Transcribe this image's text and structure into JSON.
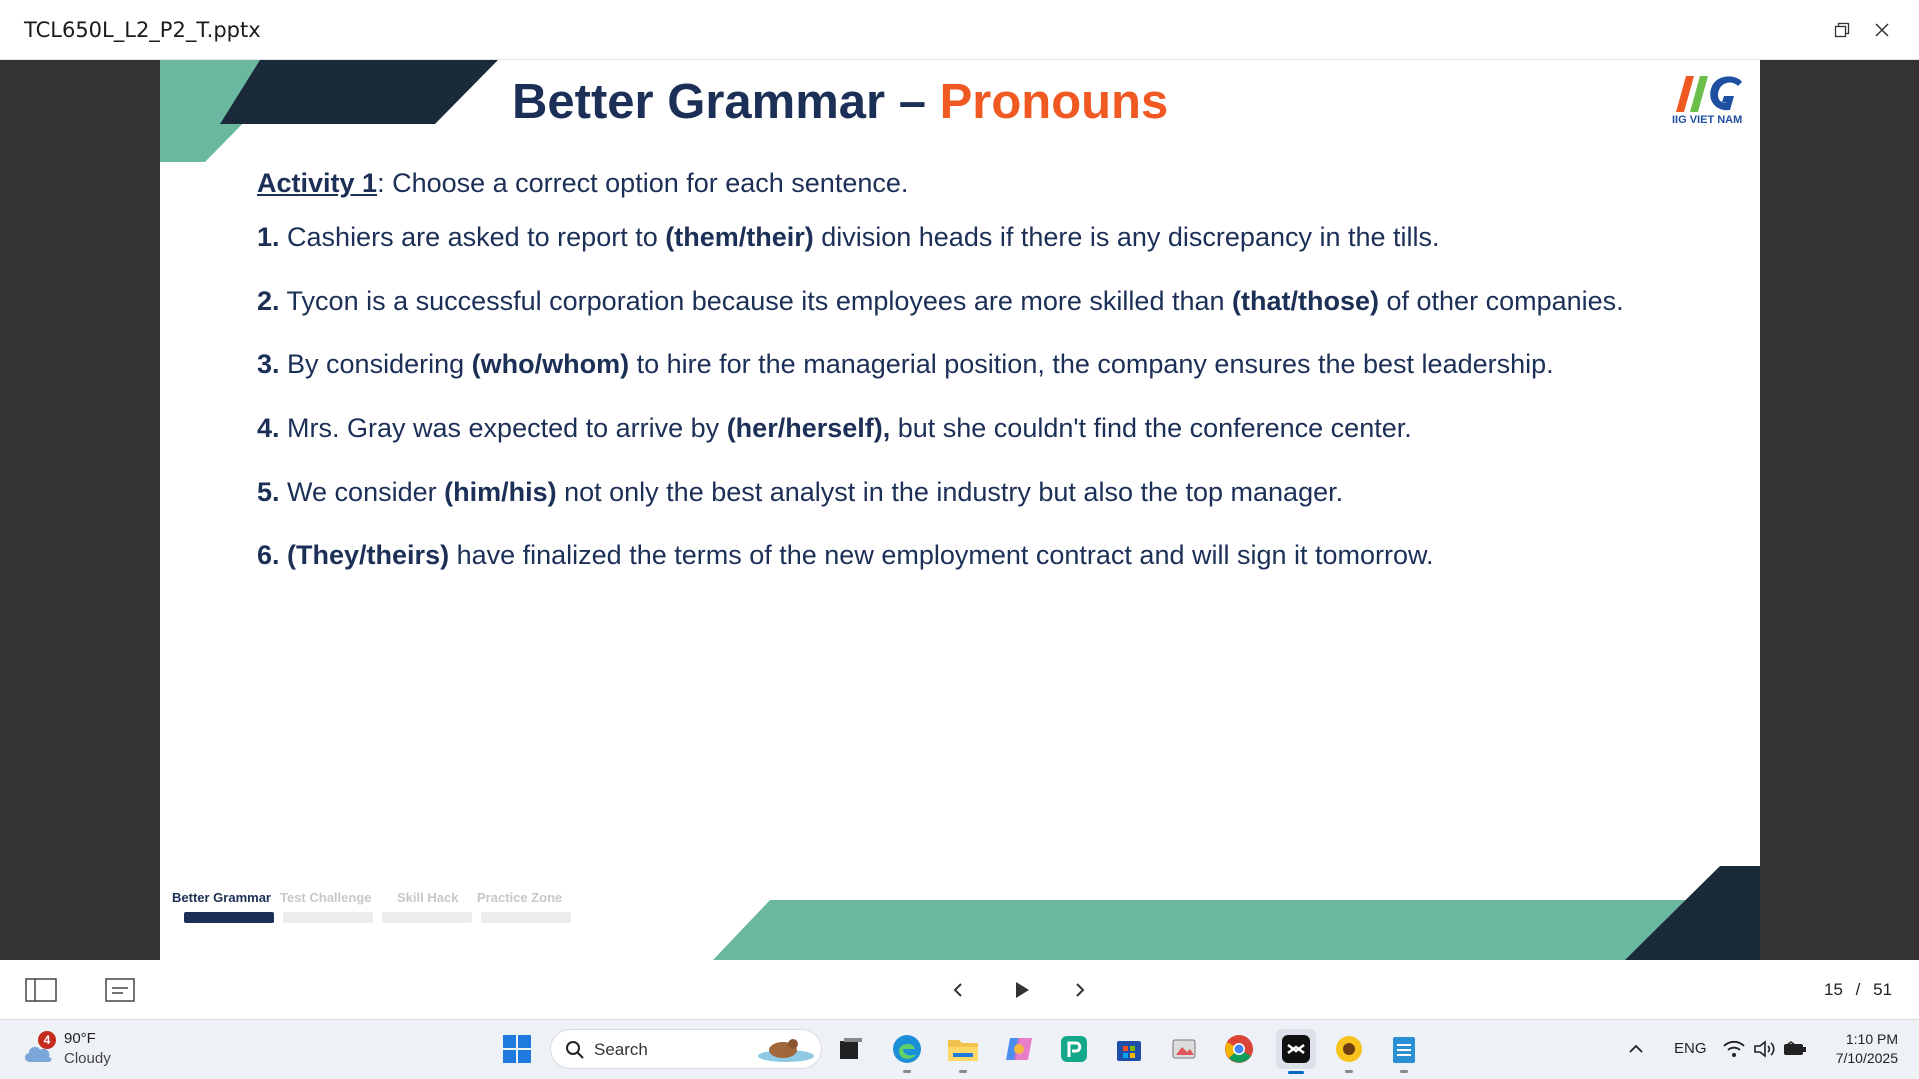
{
  "window": {
    "title": "TCL650L_L2_P2_T.pptx",
    "restore_icon": "restore-icon",
    "close_icon": "close-icon"
  },
  "slide": {
    "title_main": "Better Grammar – ",
    "title_accent": "Pronouns",
    "logo_text": "IIG VIET NAM",
    "activity_label": "Activity 1",
    "activity_text": ": Choose a correct option for each sentence.",
    "questions": [
      {
        "num": "1.",
        "pre": " Cashiers are asked to report to ",
        "opt": "(them/their)",
        "post": " division heads if there is any discrepancy in the tills."
      },
      {
        "num": "2.",
        "pre": " Tycon is a successful corporation because its employees are more skilled than ",
        "opt": "(that/those)",
        "post": " of other companies."
      },
      {
        "num": "3.",
        "pre": " By considering ",
        "opt": "(who/whom)",
        "post": " to hire for the managerial position, the company ensures the best leadership."
      },
      {
        "num": "4.",
        "pre": " Mrs. Gray was expected to arrive by ",
        "opt": "(her/herself),",
        "post": " but she couldn't find the conference center."
      },
      {
        "num": "5.",
        "pre": " We consider ",
        "opt": "(him/his)",
        "post": " not only the best analyst in the industry but also the top manager."
      },
      {
        "num": "6.",
        "pre": " ",
        "opt": "(They/theirs)",
        "post": " have finalized the terms of the new employment contract and will sign it tomorrow."
      }
    ],
    "progress": [
      {
        "label": "Better Grammar",
        "active": true
      },
      {
        "label": "Test Challenge",
        "active": false
      },
      {
        "label": "Skill Hack",
        "active": false
      },
      {
        "label": "Practice Zone",
        "active": false
      }
    ],
    "colors": {
      "navy": "#1c2f56",
      "orange": "#f05a22",
      "teal": "#6bb8a0",
      "dark": "#1a2a3a"
    }
  },
  "toolbar": {
    "current_page": "15",
    "separator": "/",
    "total_pages": "51",
    "icons": [
      "sidebar-toggle-icon",
      "notes-icon",
      "previous-icon",
      "play-icon",
      "next-icon"
    ]
  },
  "taskbar": {
    "weather_badge": "4",
    "temperature": "90°F",
    "condition": "Cloudy",
    "search_placeholder": "Search",
    "language": "ENG",
    "time": "1:10 PM",
    "date": "7/10/2025"
  }
}
